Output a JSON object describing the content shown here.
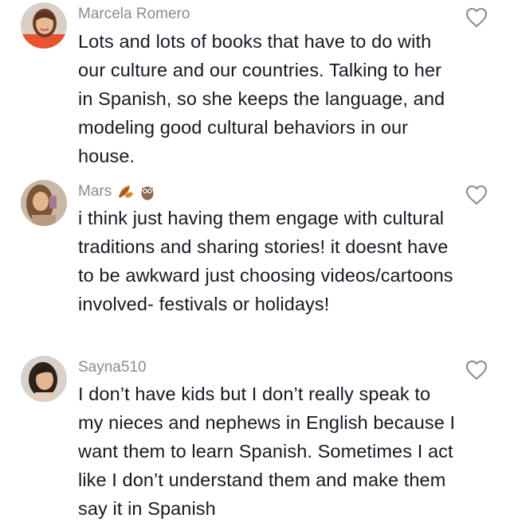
{
  "comments": [
    {
      "username": "Marcela Romero",
      "text": "Lots and lots of books that have to do with our culture and our countries. Talking to her in Spanish, so she keeps the language, and modeling good cultural behaviors in our house.",
      "avatar_icon": "user-photo-avatar",
      "like_icon": "heart-outline-icon"
    },
    {
      "username": "Mars",
      "username_emojis": [
        "fallen-leaf-emoji",
        "owl-emoji"
      ],
      "text": "i think just having them engage with cultural traditions and sharing stories! it doesnt have to be awkward just choosing videos/cartoons involved- festivals or holidays!",
      "avatar_icon": "user-photo-avatar",
      "like_icon": "heart-outline-icon"
    },
    {
      "username": "Sayna510",
      "text": "I don’t have kids but I don’t really speak to my nieces and nephews in English because I want them to learn Spanish. Sometimes I act like I don’t understand them and make them say it in Spanish",
      "avatar_icon": "user-photo-avatar",
      "like_icon": "heart-outline-icon"
    }
  ],
  "colors": {
    "text": "#161823",
    "username": "#8a8b91",
    "heart_stroke": "#8a8b91"
  }
}
